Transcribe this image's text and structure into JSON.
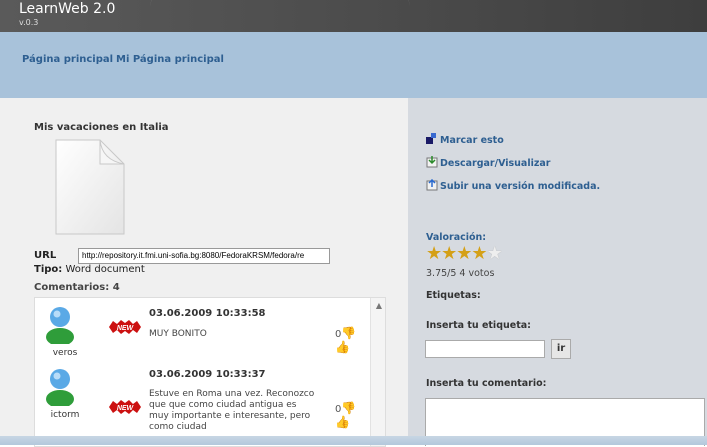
{
  "app": {
    "title": "LearnWeb 2.0",
    "version": "v.0.3"
  },
  "nav": {
    "home": "Página principal",
    "my_home": "Mi Página principal"
  },
  "document": {
    "title": "Mis vacaciones en Italia",
    "url_label": "URL",
    "url_value": "http://repository.it.fmi.uni-sofia.bg:8080/FedoraKRSM/fedora/re",
    "type_label": "Tipo:",
    "type_value": "Word document",
    "icon": "document-icon"
  },
  "comments": {
    "header": "Comentarios: 4",
    "items": [
      {
        "user": "veros",
        "badge": "NEW",
        "date": "03.06.2009 10:33:58",
        "text": "MUY BONITO",
        "votes": "0"
      },
      {
        "user": "ictorm",
        "badge": "NEW",
        "date": "03.06.2009 10:33:37",
        "text": "Estuve en Roma una vez. Reconozco que que como ciudad antigua es muy importante e interesante, pero como ciudad",
        "votes": "0"
      }
    ]
  },
  "actions": {
    "bookmark": "Marcar esto",
    "download": "Descargar/Visualizar",
    "upload": "Subir una versión modificada."
  },
  "rating": {
    "label": "Valoración:",
    "value": 3.75,
    "max": 5,
    "text": "3.75/5 4 votos"
  },
  "tags": {
    "label": "Etiquetas:",
    "prompt": "Inserta tu etiqueta:",
    "button": "ir"
  },
  "comment_form": {
    "prompt": "Inserta tu comentario:"
  },
  "colors": {
    "accent": "#2e5f91",
    "nav_bg": "#a8c2da",
    "header_bg": "#4b4b4b",
    "sidebar_bg": "#d6dae0",
    "star": "#d4a017",
    "badge": "#cc1111"
  }
}
